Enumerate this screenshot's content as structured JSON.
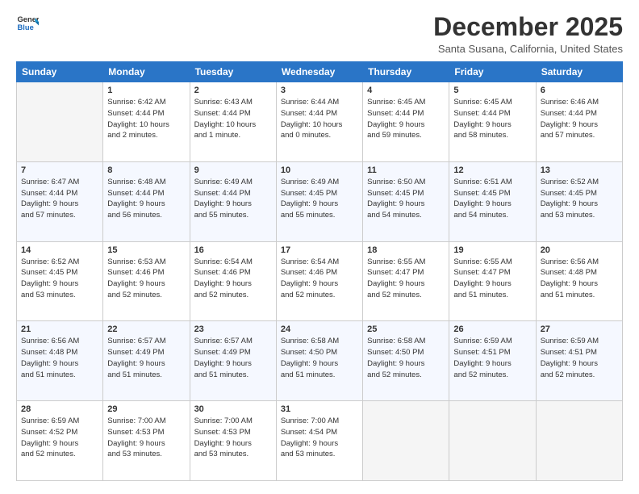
{
  "header": {
    "logo_line1": "General",
    "logo_line2": "Blue",
    "month": "December 2025",
    "location": "Santa Susana, California, United States"
  },
  "weekdays": [
    "Sunday",
    "Monday",
    "Tuesday",
    "Wednesday",
    "Thursday",
    "Friday",
    "Saturday"
  ],
  "weeks": [
    [
      {
        "day": "",
        "info": ""
      },
      {
        "day": "1",
        "info": "Sunrise: 6:42 AM\nSunset: 4:44 PM\nDaylight: 10 hours\nand 2 minutes."
      },
      {
        "day": "2",
        "info": "Sunrise: 6:43 AM\nSunset: 4:44 PM\nDaylight: 10 hours\nand 1 minute."
      },
      {
        "day": "3",
        "info": "Sunrise: 6:44 AM\nSunset: 4:44 PM\nDaylight: 10 hours\nand 0 minutes."
      },
      {
        "day": "4",
        "info": "Sunrise: 6:45 AM\nSunset: 4:44 PM\nDaylight: 9 hours\nand 59 minutes."
      },
      {
        "day": "5",
        "info": "Sunrise: 6:45 AM\nSunset: 4:44 PM\nDaylight: 9 hours\nand 58 minutes."
      },
      {
        "day": "6",
        "info": "Sunrise: 6:46 AM\nSunset: 4:44 PM\nDaylight: 9 hours\nand 57 minutes."
      }
    ],
    [
      {
        "day": "7",
        "info": "Sunrise: 6:47 AM\nSunset: 4:44 PM\nDaylight: 9 hours\nand 57 minutes."
      },
      {
        "day": "8",
        "info": "Sunrise: 6:48 AM\nSunset: 4:44 PM\nDaylight: 9 hours\nand 56 minutes."
      },
      {
        "day": "9",
        "info": "Sunrise: 6:49 AM\nSunset: 4:44 PM\nDaylight: 9 hours\nand 55 minutes."
      },
      {
        "day": "10",
        "info": "Sunrise: 6:49 AM\nSunset: 4:45 PM\nDaylight: 9 hours\nand 55 minutes."
      },
      {
        "day": "11",
        "info": "Sunrise: 6:50 AM\nSunset: 4:45 PM\nDaylight: 9 hours\nand 54 minutes."
      },
      {
        "day": "12",
        "info": "Sunrise: 6:51 AM\nSunset: 4:45 PM\nDaylight: 9 hours\nand 54 minutes."
      },
      {
        "day": "13",
        "info": "Sunrise: 6:52 AM\nSunset: 4:45 PM\nDaylight: 9 hours\nand 53 minutes."
      }
    ],
    [
      {
        "day": "14",
        "info": "Sunrise: 6:52 AM\nSunset: 4:45 PM\nDaylight: 9 hours\nand 53 minutes."
      },
      {
        "day": "15",
        "info": "Sunrise: 6:53 AM\nSunset: 4:46 PM\nDaylight: 9 hours\nand 52 minutes."
      },
      {
        "day": "16",
        "info": "Sunrise: 6:54 AM\nSunset: 4:46 PM\nDaylight: 9 hours\nand 52 minutes."
      },
      {
        "day": "17",
        "info": "Sunrise: 6:54 AM\nSunset: 4:46 PM\nDaylight: 9 hours\nand 52 minutes."
      },
      {
        "day": "18",
        "info": "Sunrise: 6:55 AM\nSunset: 4:47 PM\nDaylight: 9 hours\nand 52 minutes."
      },
      {
        "day": "19",
        "info": "Sunrise: 6:55 AM\nSunset: 4:47 PM\nDaylight: 9 hours\nand 51 minutes."
      },
      {
        "day": "20",
        "info": "Sunrise: 6:56 AM\nSunset: 4:48 PM\nDaylight: 9 hours\nand 51 minutes."
      }
    ],
    [
      {
        "day": "21",
        "info": "Sunrise: 6:56 AM\nSunset: 4:48 PM\nDaylight: 9 hours\nand 51 minutes."
      },
      {
        "day": "22",
        "info": "Sunrise: 6:57 AM\nSunset: 4:49 PM\nDaylight: 9 hours\nand 51 minutes."
      },
      {
        "day": "23",
        "info": "Sunrise: 6:57 AM\nSunset: 4:49 PM\nDaylight: 9 hours\nand 51 minutes."
      },
      {
        "day": "24",
        "info": "Sunrise: 6:58 AM\nSunset: 4:50 PM\nDaylight: 9 hours\nand 51 minutes."
      },
      {
        "day": "25",
        "info": "Sunrise: 6:58 AM\nSunset: 4:50 PM\nDaylight: 9 hours\nand 52 minutes."
      },
      {
        "day": "26",
        "info": "Sunrise: 6:59 AM\nSunset: 4:51 PM\nDaylight: 9 hours\nand 52 minutes."
      },
      {
        "day": "27",
        "info": "Sunrise: 6:59 AM\nSunset: 4:51 PM\nDaylight: 9 hours\nand 52 minutes."
      }
    ],
    [
      {
        "day": "28",
        "info": "Sunrise: 6:59 AM\nSunset: 4:52 PM\nDaylight: 9 hours\nand 52 minutes."
      },
      {
        "day": "29",
        "info": "Sunrise: 7:00 AM\nSunset: 4:53 PM\nDaylight: 9 hours\nand 53 minutes."
      },
      {
        "day": "30",
        "info": "Sunrise: 7:00 AM\nSunset: 4:53 PM\nDaylight: 9 hours\nand 53 minutes."
      },
      {
        "day": "31",
        "info": "Sunrise: 7:00 AM\nSunset: 4:54 PM\nDaylight: 9 hours\nand 53 minutes."
      },
      {
        "day": "",
        "info": ""
      },
      {
        "day": "",
        "info": ""
      },
      {
        "day": "",
        "info": ""
      }
    ]
  ]
}
